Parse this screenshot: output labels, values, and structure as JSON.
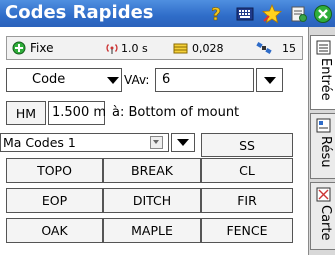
{
  "window": {
    "title": "Codes Rapides",
    "icons": [
      "help-icon",
      "keyboard-icon",
      "star-icon",
      "settings-icon",
      "close-icon"
    ]
  },
  "status": {
    "fix_label": "Fixe",
    "interval": "1.0 s",
    "precision": "0,028",
    "satellites": "15"
  },
  "form": {
    "code_select": "Code",
    "vav_label": "VAv:",
    "vav_value": "6",
    "hm_button": "HM",
    "hm_value": "1.500 m",
    "hm_desc": "à: Bottom of mount",
    "list_select": "Ma Codes 1",
    "ss_button": "SS"
  },
  "codes": [
    [
      "TOPO",
      "BREAK",
      "CL"
    ],
    [
      "EOP",
      "DITCH",
      "FIR"
    ],
    [
      "OAK",
      "MAPLE",
      "FENCE"
    ]
  ],
  "side_tabs": [
    {
      "label": "Entrée",
      "icon": "entry-icon"
    },
    {
      "label": "Résu",
      "icon": "results-icon"
    },
    {
      "label": "Carte",
      "icon": "map-icon"
    }
  ]
}
